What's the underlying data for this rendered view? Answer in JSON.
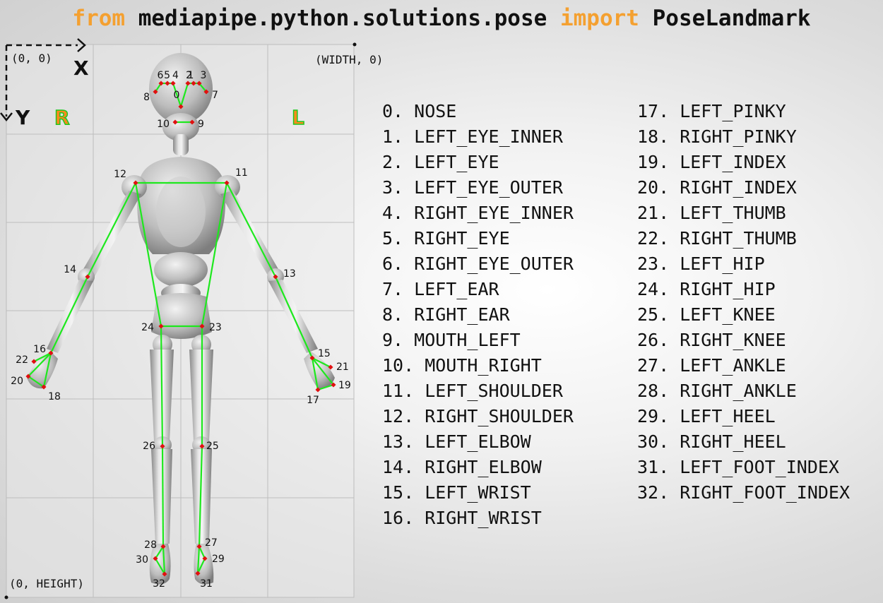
{
  "header": {
    "kw_from": "from",
    "module": " mediapipe.python.solutions.pose ",
    "kw_import": "import",
    "cls": " PoseLandmark"
  },
  "colors": {
    "keyword": "#f4a030",
    "skeleton": "#1ee81e",
    "landmark": "#e01010",
    "side_label_fill": "#ff8a1c",
    "side_label_stroke": "#1ec81e"
  },
  "axes": {
    "origin": "(0, 0)",
    "x_label": "X",
    "y_label": "Y",
    "width_label": "(WIDTH, 0)",
    "height_label": "(0, HEIGHT)",
    "right_side": "R",
    "left_side": "L"
  },
  "landmark_numbers": [
    "0",
    "1",
    "2",
    "3",
    "4",
    "5",
    "6",
    "7",
    "8",
    "9",
    "10",
    "11",
    "12",
    "13",
    "14",
    "15",
    "16",
    "17",
    "18",
    "19",
    "20",
    "21",
    "22",
    "23",
    "24",
    "25",
    "26",
    "27",
    "28",
    "29",
    "30",
    "31",
    "32"
  ],
  "landmarks_left": [
    "0. NOSE",
    "1. LEFT_EYE_INNER",
    "2. LEFT_EYE",
    "3. LEFT_EYE_OUTER",
    "4. RIGHT_EYE_INNER",
    "5. RIGHT_EYE",
    "6. RIGHT_EYE_OUTER",
    "7. LEFT_EAR",
    "8. RIGHT_EAR",
    "9. MOUTH_LEFT",
    "10. MOUTH_RIGHT",
    "11. LEFT_SHOULDER",
    "12. RIGHT_SHOULDER",
    "13. LEFT_ELBOW",
    "14. RIGHT_ELBOW",
    "15. LEFT_WRIST",
    "16. RIGHT_WRIST"
  ],
  "landmarks_right": [
    "17. LEFT_PINKY",
    "18. RIGHT_PINKY",
    "19. LEFT_INDEX",
    "20. RIGHT_INDEX",
    "21. LEFT_THUMB",
    "22. RIGHT_THUMB",
    "23. LEFT_HIP",
    "24. RIGHT_HIP",
    "25. LEFT_KNEE",
    "26. RIGHT_KNEE",
    "27. LEFT_ANKLE",
    "28. RIGHT_ANKLE",
    "29. LEFT_HEEL",
    "30. RIGHT_HEEL",
    "31. LEFT_FOOT_INDEX",
    "32. RIGHT_FOOT_INDEX"
  ]
}
